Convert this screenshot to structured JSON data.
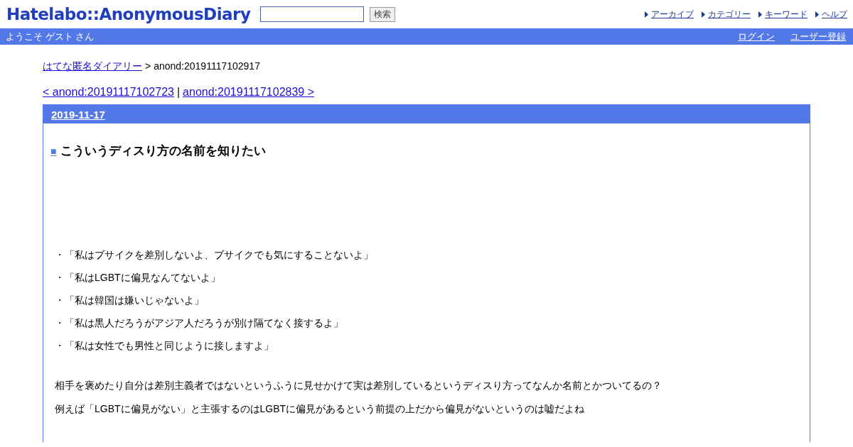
{
  "header": {
    "logo": "Hatelabo::AnonymousDiary",
    "search": {
      "button": "検索"
    },
    "nav": [
      "アーカイブ",
      "カテゴリー",
      "キーワード",
      "ヘルプ"
    ]
  },
  "welcome_bar": {
    "greeting": "ようこそ ゲスト さん",
    "links": [
      "ログイン",
      "ユーザー登録"
    ]
  },
  "breadcrumb": {
    "home": "はてな匿名ダイアリー",
    "separator": ">",
    "current": "anond:20191117102917"
  },
  "pager": {
    "prev": "< anond:20191117102723",
    "separator": "|",
    "next": "anond:20191117102839 >"
  },
  "entry": {
    "date": "2019-11-17",
    "title_mark": "■",
    "title": "こういうディスり方の名前を知りたい",
    "bullets": [
      "・「私はブサイクを差別しないよ、ブサイクでも気にすることないよ」",
      "・「私はLGBTに偏見なんてないよ」",
      "・「私は韓国は嫌いじゃないよ」",
      "・「私は黒人だろうがアジア人だろうが別け隔てなく接するよ」",
      "・「私は女性でも男性と同じように接しますよ」"
    ],
    "paragraphs": [
      "相手を褒めたり自分は差別主義者ではないというふうに見せかけて実は差別しているというディスり方ってなんか名前とかついてるの？",
      "例えば「LGBTに偏見がない」と主張するのはLGBTに偏見があるという前提の上だから偏見がないというのは嘘だよね"
    ]
  }
}
